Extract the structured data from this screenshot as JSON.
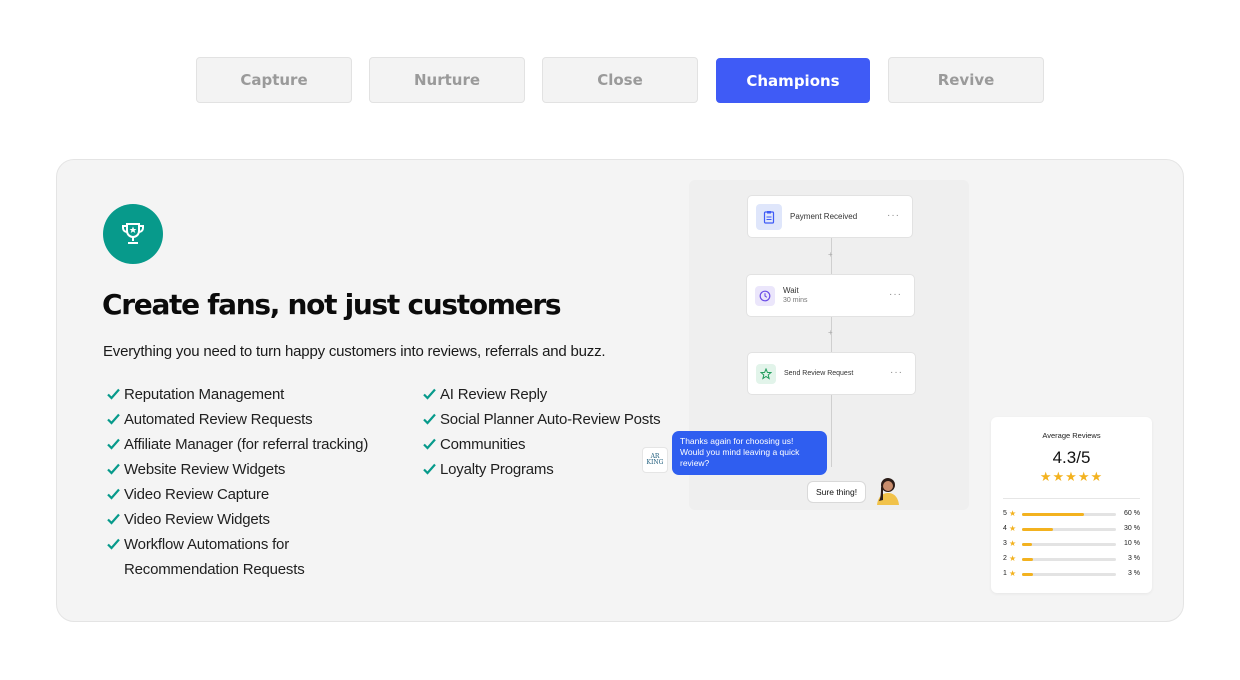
{
  "tabs": [
    {
      "label": "Capture",
      "active": false
    },
    {
      "label": "Nurture",
      "active": false
    },
    {
      "label": "Close",
      "active": false
    },
    {
      "label": "Champions",
      "active": true
    },
    {
      "label": "Revive",
      "active": false
    }
  ],
  "card": {
    "icon": "trophy-icon",
    "headline": "Create fans, not just customers",
    "subline": "Everything you need to turn happy customers into reviews, referrals and buzz.",
    "features_left": [
      "Reputation Management",
      "Automated Review Requests",
      "Affiliate Manager (for referral tracking)",
      "Website Review Widgets",
      "Video Review Capture",
      "Video Review Widgets",
      "Workflow Automations for Recommendation Requests"
    ],
    "features_right": [
      "AI Review Reply",
      "Social Planner Auto-Review Posts",
      "Communities",
      "Loyalty Programs"
    ]
  },
  "workflow": {
    "nodes": [
      {
        "label": "Payment Received",
        "sub": "",
        "icon": "clipboard-icon"
      },
      {
        "label": "Wait",
        "sub": "30 mins",
        "icon": "clock-icon"
      },
      {
        "label": "Send Review Request",
        "sub": "",
        "icon": "star-icon"
      }
    ],
    "plus": "+",
    "more": "···"
  },
  "chat": {
    "logo_text": "AR KING",
    "message": "Thanks again for choosing us! Would you mind leaving a quick review?",
    "reply": "Sure thing!"
  },
  "reviews": {
    "title": "Average Reviews",
    "score": "4.3/5",
    "stars": "★★★★★",
    "breakdown": [
      {
        "star": "5",
        "percent": 60,
        "label": "60 %"
      },
      {
        "star": "4",
        "percent": 30,
        "label": "30 %"
      },
      {
        "star": "3",
        "percent": 10,
        "label": "10 %"
      },
      {
        "star": "2",
        "percent": 3,
        "label": "3 %"
      },
      {
        "star": "1",
        "percent": 3,
        "label": "3 %"
      }
    ]
  },
  "colors": {
    "accent": "#3f5bf6",
    "teal": "#079a8b",
    "star": "#f3b21f",
    "bubble": "#2f5ef0"
  }
}
